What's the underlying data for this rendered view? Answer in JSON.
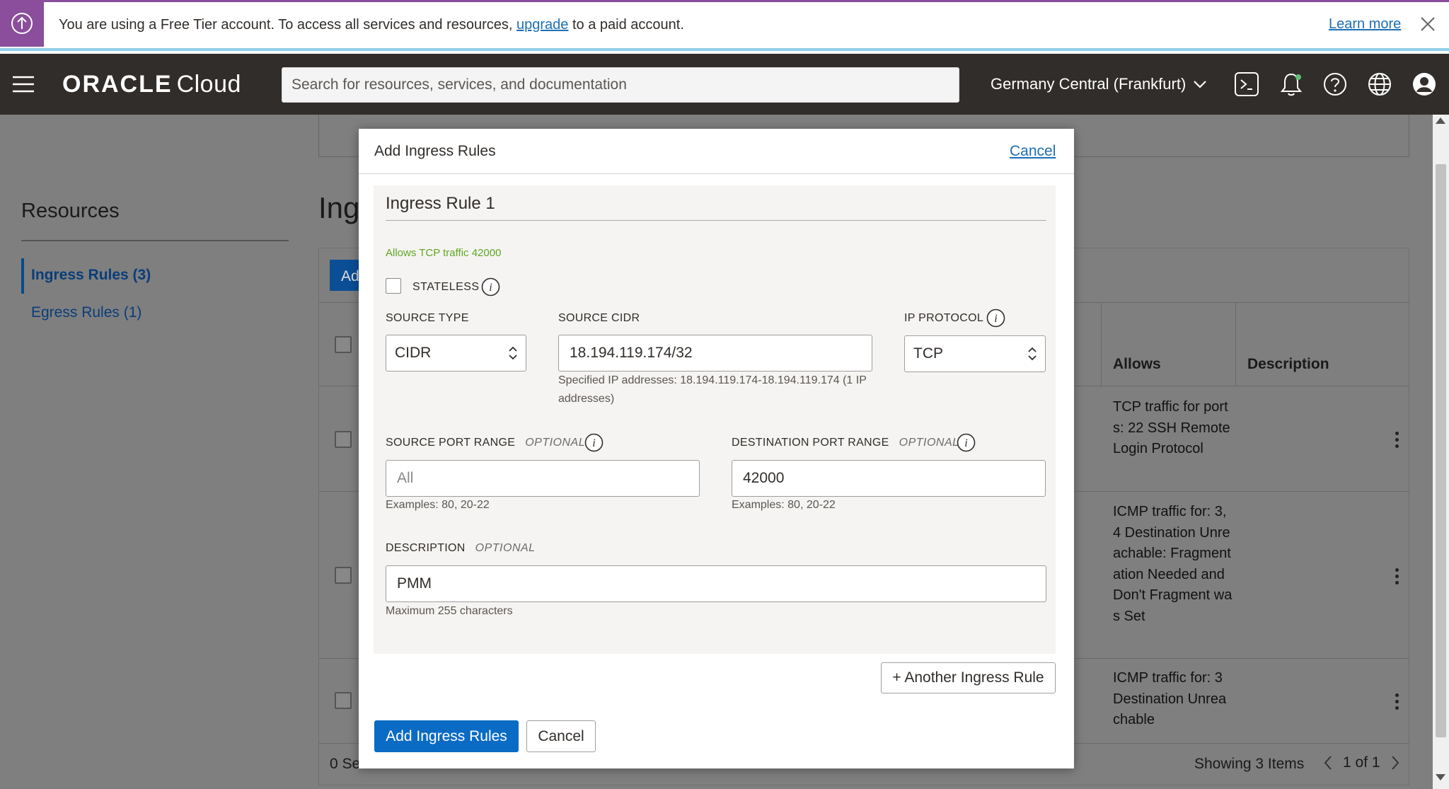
{
  "banner": {
    "text_before": "You are using a Free Tier account. To access all services and resources, ",
    "upgrade_link": "upgrade",
    "text_after": " to a paid account.",
    "learn_more": "Learn more",
    "accent_color": "#8a4e9c"
  },
  "header": {
    "logo_brand": "ORACLE",
    "logo_product": "Cloud",
    "search_placeholder": "Search for resources, services, and documentation",
    "region": "Germany Central (Frankfurt)",
    "icons": [
      "cloud-shell-icon",
      "notifications-icon",
      "help-icon",
      "language-icon",
      "profile-icon"
    ]
  },
  "sidebar": {
    "title": "Resources",
    "items": [
      {
        "label": "Ingress Rules (3)",
        "active": true
      },
      {
        "label": "Egress Rules (1)",
        "active": false
      }
    ]
  },
  "background_table": {
    "heading": "Ing",
    "add_button": "Ad",
    "columns": [
      "Allows",
      "Description"
    ],
    "rows": [
      {
        "allows": "TCP traffic for ports: 22 SSH Remote Login Protocol"
      },
      {
        "allows": "ICMP traffic for: 3, 4 Destination Unreachable: Fragmentation Needed and Don't Fragment was Set"
      },
      {
        "allows": "ICMP traffic for: 3 Destination Unreachable"
      }
    ],
    "selected": "0 Se",
    "showing": "Showing 3 Items",
    "pager": "1 of 1"
  },
  "modal": {
    "title": "Add Ingress Rules",
    "cancel_link": "Cancel",
    "rule": {
      "title": "Ingress Rule 1",
      "summary": "Allows TCP traffic 42000",
      "stateless_label": "STATELESS",
      "stateless_checked": false,
      "source_type_label": "SOURCE TYPE",
      "source_type_value": "CIDR",
      "source_cidr_label": "SOURCE CIDR",
      "source_cidr_value": "18.194.119.174/32",
      "source_cidr_helper": "Specified IP addresses: 18.194.119.174-18.194.119.174 (1 IP addresses)",
      "ip_protocol_label": "IP PROTOCOL",
      "ip_protocol_value": "TCP",
      "source_port_label": "SOURCE PORT RANGE",
      "source_port_optional": "OPTIONAL",
      "source_port_placeholder": "All",
      "source_port_helper": "Examples: 80, 20-22",
      "dest_port_label": "DESTINATION PORT RANGE",
      "dest_port_optional": "OPTIONAL",
      "dest_port_value": "42000",
      "dest_port_helper": "Examples: 80, 20-22",
      "description_label": "DESCRIPTION",
      "description_optional": "OPTIONAL",
      "description_value": "PMM",
      "description_helper": "Maximum 255 characters"
    },
    "another_rule_button": "+ Another Ingress Rule",
    "submit_button": "Add Ingress Rules",
    "cancel_button": "Cancel",
    "primary_color": "#0a6bc4"
  }
}
